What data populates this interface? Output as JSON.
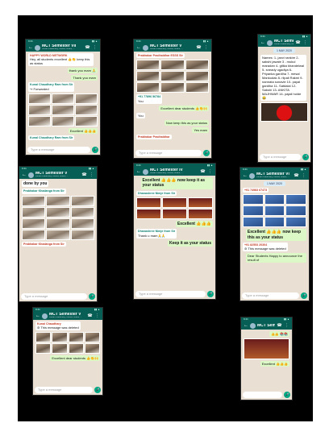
{
  "phones": [
    {
      "title": "MCT Semester VII",
      "subtitle": "Kunal Chaudhary, Kesha, Ishani, ...",
      "messages": [
        {
          "sender": "HAPPY WORLD NETWORK",
          "text": "Hey, all students excellent 👍👏 keep this as status"
        },
        {
          "text": "thank you mam 🙏",
          "out": true
        },
        {
          "text": "Thank you mam",
          "out": true
        },
        {
          "sender": "Kunal Chaudhary Ram from Sir",
          "text": "↪ Forwarded"
        },
        {
          "text": "Excellent 👍👍👍",
          "out": true
        },
        {
          "sender": "Kunal Chaudhary Ram from Sir",
          "text": ""
        }
      ],
      "input_placeholder": "Type a message"
    },
    {
      "title": "MCT Semester V",
      "subtitle": "Kunal Chaudhary, Kesha, Ishani, ...",
      "messages": [
        {
          "sender": "Prabhakar Pradhaldhar ESSS Sir",
          "text": ""
        },
        {
          "sender": "+91 77896 56784",
          "text": "You"
        },
        {
          "text": "Excellent dear students 👍👏🙌",
          "out": true
        },
        {
          "text": "You"
        },
        {
          "text": "Now keep this as your status",
          "out": true
        },
        {
          "text": "Yes mam",
          "out": true
        },
        {
          "sender": "Prabhakar Pradhaldhar",
          "text": ""
        }
      ],
      "input_placeholder": "Type a message"
    },
    {
      "title": "MCT Semester II",
      "subtitle": "Kunal Chaudhary, Kesha, Ishani, ...",
      "date_pill": "1 MAY 2020",
      "messages": [
        {
          "text": "Names: 1- janvi rankire 2- sakshi jawale 3 - mukul maradan 4- gitika khandelwal 5- sneady ugadiya 6- Priyanka gardiha 7- mesal Mankudak 8- rlipali Rakmi 9-namrata sonavle 10- payal gardiha 11- Satdalal 12- Sakshi 13- ANKITA MAJHWAR 14- pajali holde😂"
        }
      ],
      "input_placeholder": "Type a message"
    },
    {
      "title": "MCT Semester V",
      "subtitle": "Kunal Chaudhary, Kesha, Ishani, ...",
      "messages": [
        {
          "text": "done by you",
          "big": true
        },
        {
          "sender": "Prabhakar Khadanga from Sir",
          "text": ""
        },
        {
          "sender": "Prabhakar Khadanga from Sir",
          "text": ""
        }
      ],
      "input_placeholder": "Type a message"
    },
    {
      "title": "MCT Semester IV",
      "subtitle": "Kunal Chaudhary, Kesha, Ishani, ...",
      "messages": [
        {
          "text": "Excellent 👍👍👍 now keep it as your status",
          "big": true,
          "out": true
        },
        {
          "sender": "Dhanashree Nimje from Sir",
          "text": ""
        },
        {
          "text": "Excellent 👍👍👍",
          "big": true,
          "out": true
        },
        {
          "sender": "Dhanashree Nimje from Sir",
          "text": "Thank u mam🙏🙏"
        },
        {
          "text": "Keep it as your status",
          "big": true,
          "out": true
        }
      ],
      "input_placeholder": "Type a message"
    },
    {
      "title": "MCT Semester VI",
      "subtitle": "Kunal Chaudhary, Kesha, Ishani, ...",
      "date_pill": "1 MAY 2020",
      "messages": [
        {
          "sender": "+91 74983 67473",
          "text": ""
        },
        {
          "text": "Excellent 👍👍👍 now keep this as your status",
          "big": true,
          "out": true
        },
        {
          "sender": "+91 82553 20304",
          "text": "⊘ This message was deleted"
        },
        {
          "text": "Dear Students Happy to announce the result of",
          "out": true
        }
      ],
      "input_placeholder": "Type a message"
    },
    {
      "title": "MCT Semester V",
      "subtitle": "Kunal Chaudhary, Kesha, Ishani, ...",
      "messages": [
        {
          "sender": "Kunal Chaudhary",
          "text": "⊘ This message was deleted"
        },
        {
          "text": "Excellent dear students 👍👏🙌",
          "out": true
        }
      ],
      "input_placeholder": "Type a message"
    },
    {
      "title": "MCT Semester",
      "subtitle": "",
      "messages": [
        {
          "text": "👍👍 📚📚",
          "out": true
        },
        {
          "text": "Excellent 👍👍👍",
          "out": true
        }
      ],
      "input_placeholder": ""
    }
  ]
}
